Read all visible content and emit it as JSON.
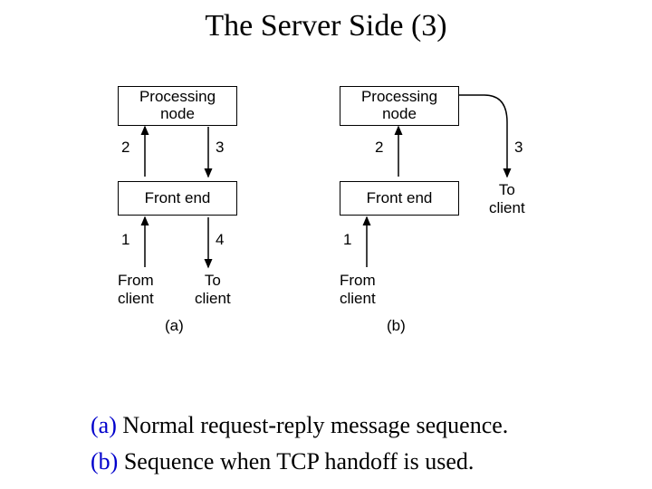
{
  "title": "The Server Side (3)",
  "diagram": {
    "a": {
      "processing_node": "Processing\nnode",
      "front_end": "Front end",
      "from_client": "From\nclient",
      "to_client": "To\nclient",
      "n1": "1",
      "n2": "2",
      "n3": "3",
      "n4": "4",
      "tag": "(a)"
    },
    "b": {
      "processing_node": "Processing\nnode",
      "front_end": "Front end",
      "from_client": "From\nclient",
      "to_client": "To\nclient",
      "n1": "1",
      "n2": "2",
      "n3": "3",
      "tag": "(b)"
    }
  },
  "captions": {
    "a_prefix": "(a)",
    "a_text": " Normal request-reply message sequence.",
    "b_prefix": "(b)",
    "b_text": " Sequence when TCP handoff is used."
  }
}
